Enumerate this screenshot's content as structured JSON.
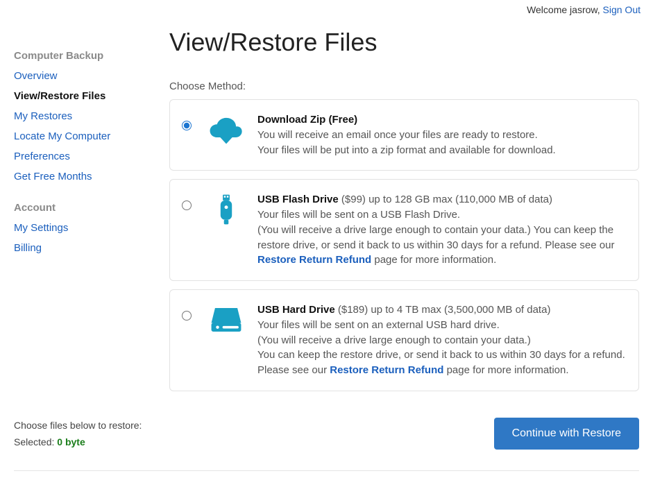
{
  "topbar": {
    "welcome": "Welcome jasrow, ",
    "signout": "Sign Out"
  },
  "sidebar": {
    "backup_heading": "Computer Backup",
    "backup_items": [
      {
        "label": "Overview",
        "active": false
      },
      {
        "label": "View/Restore Files",
        "active": true
      },
      {
        "label": "My Restores",
        "active": false
      },
      {
        "label": "Locate My Computer",
        "active": false
      },
      {
        "label": "Preferences",
        "active": false
      },
      {
        "label": "Get Free Months",
        "active": false
      }
    ],
    "account_heading": "Account",
    "account_items": [
      {
        "label": "My Settings"
      },
      {
        "label": "Billing"
      }
    ]
  },
  "page": {
    "title": "View/Restore Files",
    "choose_method": "Choose Method:"
  },
  "options": {
    "zip": {
      "title": "Download Zip (Free)",
      "line1": "You will receive an email once your files are ready to restore.",
      "line2": "Your files will be put into a zip format and available for download."
    },
    "flash": {
      "title": "USB Flash Drive",
      "title_extra": " ($99) up to 128 GB max (110,000 MB of data)",
      "line1": "Your files will be sent on a USB Flash Drive.",
      "line2a": "(You will receive a drive large enough to contain your data.) You can keep the restore drive, or send it back to us within 30 days for a refund. Please see our ",
      "link": "Restore Return Refund",
      "line2b": " page for more information."
    },
    "hdd": {
      "title": "USB Hard Drive",
      "title_extra": " ($189) up to 4 TB max (3,500,000 MB of data)",
      "line1": "Your files will be sent on an external USB hard drive.",
      "line2": "(You will receive a drive large enough to contain your data.)",
      "line3a": "You can keep the restore drive, or send it back to us within 30 days for a refund. Please see our ",
      "link": "Restore Return Refund",
      "line3b": " page for more information."
    }
  },
  "footer": {
    "choose_files": "Choose files below to restore:",
    "selected_label": "Selected: ",
    "selected_value": "0 byte",
    "continue": "Continue with Restore"
  },
  "colors": {
    "accent_blue": "#1b75d0",
    "link_blue": "#1b5fbd",
    "icon_teal": "#1aa0c4",
    "button_blue": "#2f78c5",
    "selected_green": "#1a7d1a"
  }
}
